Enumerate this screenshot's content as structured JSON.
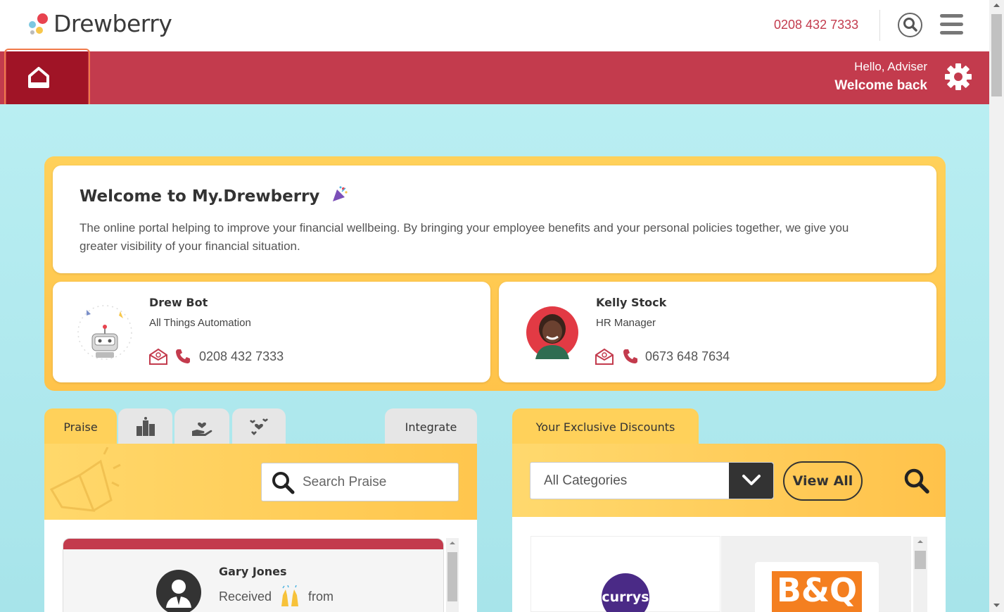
{
  "header": {
    "brand": "Drewberry",
    "phone": "0208 432 7333",
    "colors": {
      "accent": "#c33b4d",
      "home_active": "#a01426",
      "panel": "#ffc94d",
      "background": "#aee8ee"
    }
  },
  "banner": {
    "greeting": "Hello, Adviser",
    "welcome": "Welcome back"
  },
  "welcome": {
    "title": "Welcome to My.Drewberry",
    "description": "The online portal helping to improve your financial wellbeing. By bringing your employee benefits and your personal policies together, we give you greater visibility of your financial situation."
  },
  "contacts": [
    {
      "name": "Drew Bot",
      "role": "All Things Automation",
      "phone": "0208 432 7333"
    },
    {
      "name": "Kelly Stock",
      "role": "HR Manager",
      "phone": "0673 648 7634"
    }
  ],
  "praise": {
    "tabs": {
      "praise": "Praise",
      "integrate": "Integrate"
    },
    "icon_tabs": [
      "podium-icon",
      "hand-heart-icon",
      "hearts-icon"
    ],
    "search_placeholder": "Search Praise",
    "card": {
      "name": "Gary Jones",
      "received": "Received",
      "from": "from"
    }
  },
  "discounts": {
    "tab": "Your Exclusive Discounts",
    "category": "All Categories",
    "view_all": "View All",
    "brands": [
      "currys",
      "B&Q"
    ]
  }
}
